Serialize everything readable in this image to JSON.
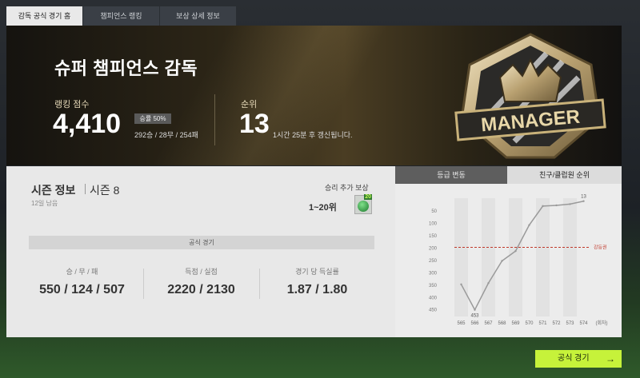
{
  "tabs": [
    "감독 공식 경기 홈",
    "챔피언스 랭킹",
    "보상 상세 정보"
  ],
  "hero": {
    "title": "슈퍼 챔피언스 감독",
    "ranking_score_label": "랭킹 점수",
    "ranking_score": "4,410",
    "win_rate": "승률 50%",
    "record": "292승 / 28무 / 254패",
    "rank_label": "순위",
    "rank": "13",
    "update_text": "1시간 25분 후 갱신됩니다.",
    "badge_text": "MANAGER"
  },
  "season": {
    "title": "시즌 정보",
    "number": "시즌 8",
    "remaining": "12일 남음",
    "reward_label": "승리 추가 보상",
    "reward_range": "1~20위",
    "reward_count": "20"
  },
  "official_match": {
    "header": "공식 경기",
    "stats": [
      {
        "label": "승 / 무 / 패",
        "value": "550 / 124 / 507"
      },
      {
        "label": "득점 / 실점",
        "value": "2220 / 2130"
      },
      {
        "label": "경기 당 득실률",
        "value": "1.87 / 1.80"
      }
    ]
  },
  "chart_tabs": [
    "등급 변동",
    "친구/클럽원 순위"
  ],
  "chart_data": {
    "type": "line",
    "x": [
      565,
      566,
      567,
      568,
      569,
      570,
      571,
      572,
      573,
      574
    ],
    "xlabel": "(회차)",
    "y_ticks": [
      50,
      100,
      150,
      200,
      250,
      300,
      350,
      400,
      450
    ],
    "ylim": [
      1,
      480
    ],
    "y_inverted": true,
    "series": [
      {
        "values": [
          350,
          453,
          345,
          255,
          215,
          110,
          33,
          30,
          25,
          13
        ]
      }
    ],
    "point_labels": [
      {
        "index": 1,
        "text": "453"
      },
      {
        "index": 9,
        "text": "13"
      }
    ],
    "threshold": {
      "value": 200,
      "label": "강등권",
      "color": "#c0392b"
    },
    "line_color": "#9a9a9a"
  },
  "play_button": {
    "label": "공식 경기",
    "arrow": "→"
  }
}
